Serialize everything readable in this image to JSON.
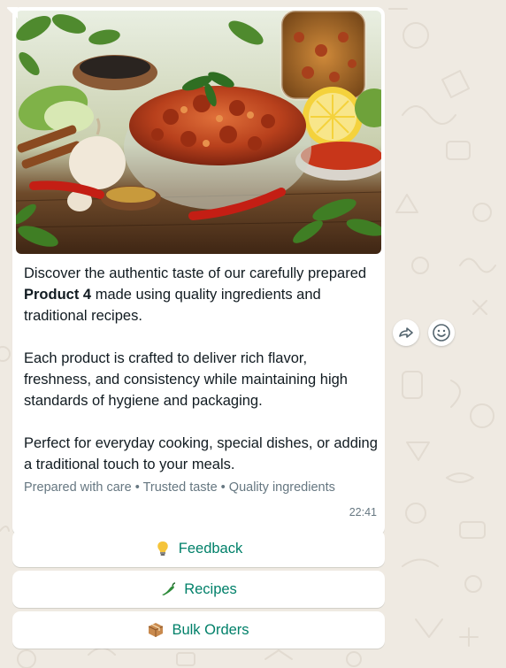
{
  "message": {
    "image_icon": "food-pickle-photo",
    "caption": {
      "p1_before": "Discover the authentic taste of our carefully prepared ",
      "p1_bold": "Product 4",
      "p1_after": " made using quality ingredients and traditional recipes.",
      "p2": "Each product is crafted to deliver rich flavor, freshness, and consistency while maintaining high standards of hygiene and packaging.",
      "p3": "Perfect for everyday cooking, special dishes, or adding a traditional touch to your meals."
    },
    "footer": "Prepared with care • Trusted taste • Quality ingredients",
    "time": "22:41"
  },
  "actions": {
    "forward_icon": "forward-icon",
    "react_icon": "emoji-icon"
  },
  "quick_replies": [
    {
      "icon": "lightbulb-icon",
      "label": "Feedback"
    },
    {
      "icon": "chili-icon",
      "label": "Recipes"
    },
    {
      "icon": "package-icon",
      "label": "Bulk Orders"
    }
  ],
  "colors": {
    "wallpaper": "#efeae2",
    "bubble": "#ffffff",
    "accent": "#008069",
    "meta_text": "#667781"
  }
}
